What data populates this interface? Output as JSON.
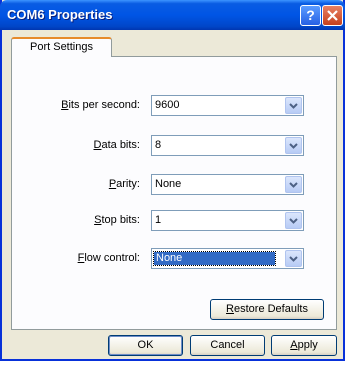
{
  "window": {
    "title": "COM6 Properties",
    "help_label": "?"
  },
  "tabs": [
    {
      "label": "Port Settings",
      "active": true
    }
  ],
  "fields": {
    "bits_per_second": {
      "label_mnemonic": "B",
      "label_rest": "its per second:",
      "value": "9600"
    },
    "data_bits": {
      "label_mnemonic": "D",
      "label_rest": "ata bits:",
      "value": "8"
    },
    "parity": {
      "label_pre": "",
      "label_mnemonic": "P",
      "label_rest": "arity:",
      "value": "None"
    },
    "stop_bits": {
      "label_mnemonic": "S",
      "label_rest": "top bits:",
      "value": "1"
    },
    "flow_control": {
      "label_mnemonic": "F",
      "label_rest": "low control:",
      "value": "None"
    }
  },
  "buttons": {
    "restore_mnemonic": "R",
    "restore_rest": "estore Defaults",
    "ok": "OK",
    "cancel": "Cancel",
    "apply_mnemonic": "A",
    "apply_rest": "pply"
  }
}
